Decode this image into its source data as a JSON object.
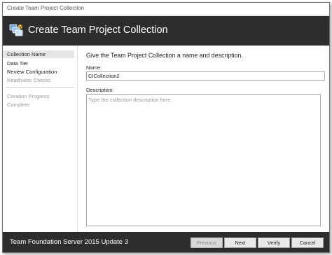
{
  "window": {
    "title": "Create Team Project Collection"
  },
  "banner": {
    "title": "Create Team Project Collection",
    "icon": "team-project-collection-icon"
  },
  "sidebar": {
    "items": [
      {
        "label": "Collection Name",
        "state": "selected"
      },
      {
        "label": "Data Tier",
        "state": "normal"
      },
      {
        "label": "Review Configuration",
        "state": "normal"
      },
      {
        "label": "Readiness Checks",
        "state": "disabled"
      },
      {
        "label": "Creation Progress",
        "state": "disabled"
      },
      {
        "label": "Complete",
        "state": "disabled"
      }
    ]
  },
  "main": {
    "heading": "Give the Team Project Collection a name and description.",
    "name_label": "Name:",
    "name_value": "CICollection2",
    "description_label": "Description:",
    "description_placeholder": "Type the collection description here."
  },
  "footer": {
    "product": "Team Foundation Server 2015 Update 3",
    "buttons": {
      "previous": "Previous",
      "next": "Next",
      "verify": "Verify",
      "cancel": "Cancel"
    }
  },
  "colors": {
    "banner_bg": "#2d2d30",
    "selected_nav_bg": "#e6e6e6",
    "disabled_text": "#9a9a9a"
  }
}
